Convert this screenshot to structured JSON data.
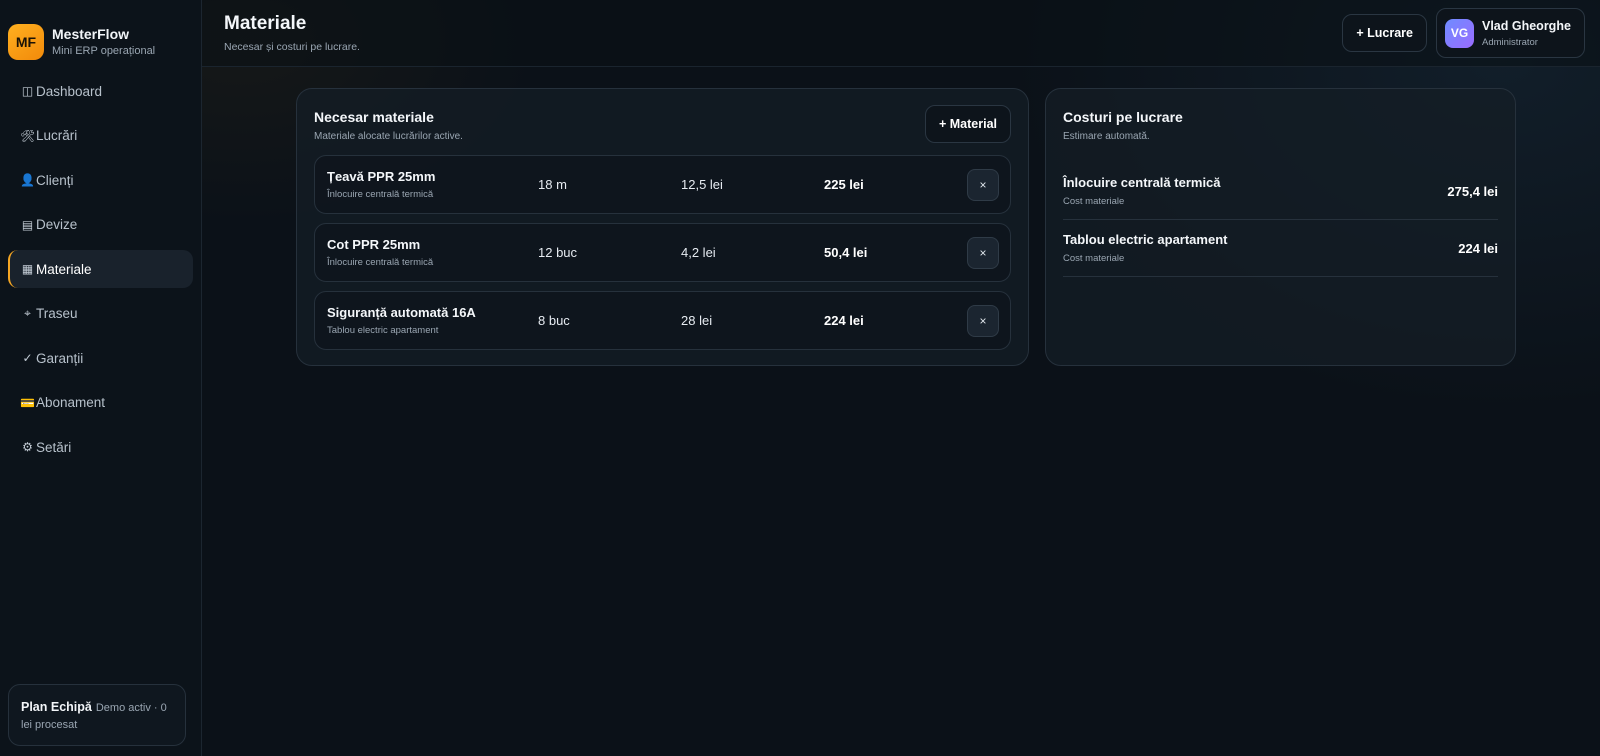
{
  "brand": {
    "logo": "MF",
    "name": "MesterFlow",
    "subtitle": "Mini ERP operațional",
    "color": "#f5a623"
  },
  "nav": [
    {
      "icon": "◫",
      "icon_name": "dashboard-icon",
      "label": "Dashboard",
      "active": false
    },
    {
      "icon": "🛠",
      "icon_name": "tools-icon",
      "label": "Lucrări",
      "active": false
    },
    {
      "icon": "👤",
      "icon_name": "user-icon",
      "label": "Clienți",
      "active": false
    },
    {
      "icon": "▤",
      "icon_name": "document-icon",
      "label": "Devize",
      "active": false
    },
    {
      "icon": "▦",
      "icon_name": "grid-icon",
      "label": "Materiale",
      "active": true
    },
    {
      "icon": "⌖",
      "icon_name": "route-icon",
      "label": "Traseu",
      "active": false
    },
    {
      "icon": "✓",
      "icon_name": "check-icon",
      "label": "Garanții",
      "active": false
    },
    {
      "icon": "💳",
      "icon_name": "card-icon",
      "label": "Abonament",
      "active": false
    },
    {
      "icon": "⚙",
      "icon_name": "gear-icon",
      "label": "Setări",
      "active": false
    }
  ],
  "plan": {
    "title": "Plan Echipă",
    "text": "Demo activ · 0 lei procesat"
  },
  "header": {
    "title": "Materiale",
    "subtitle": "Necesar și costuri pe lucrare.",
    "new_button": "+ Lucrare"
  },
  "user": {
    "initials": "VG",
    "name": "Vlad Gheorghe",
    "role": "Administrator"
  },
  "materials_panel": {
    "title": "Necesar materiale",
    "subtitle": "Materiale alocate lucrărilor active.",
    "add_button": "+ Material",
    "rows": [
      {
        "name": "Țeavă PPR 25mm",
        "job": "Înlocuire centrală termică",
        "qty": "18 m",
        "unit_price": "12,5 lei",
        "total": "225 lei",
        "delete": "×"
      },
      {
        "name": "Cot PPR 25mm",
        "job": "Înlocuire centrală termică",
        "qty": "12 buc",
        "unit_price": "4,2 lei",
        "total": "50,4 lei",
        "delete": "×"
      },
      {
        "name": "Siguranță automată 16A",
        "job": "Tablou electric apartament",
        "qty": "8 buc",
        "unit_price": "28 lei",
        "total": "224 lei",
        "delete": "×"
      }
    ]
  },
  "costs_panel": {
    "title": "Costuri pe lucrare",
    "subtitle": "Estimare automată.",
    "rows": [
      {
        "name": "Înlocuire centrală termică",
        "label": "Cost materiale",
        "value": "275,4 lei"
      },
      {
        "name": "Tablou electric apartament",
        "label": "Cost materiale",
        "value": "224 lei"
      }
    ]
  }
}
